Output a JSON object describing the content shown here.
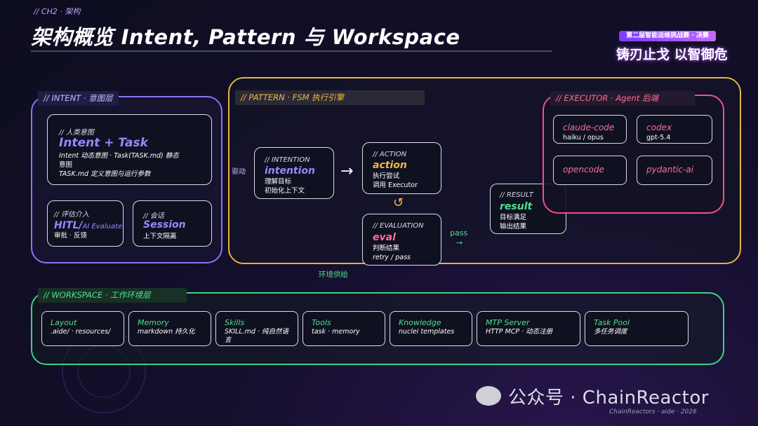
{
  "header": {
    "breadcrumb": "// CH2 · 架构",
    "title": "架构概览 Intent, Pattern 与 Workspace",
    "badge_top": "第二届智能运维挑战赛 · 决赛",
    "badge_main": "铸刃止戈 以智御危"
  },
  "intent": {
    "tag": "// INTENT · 意图层",
    "human": {
      "label": "// 人类意图",
      "title": "Intent + Task",
      "desc1": "Intent 动态意图 · Task(TASK.md) 静态",
      "desc2": "意图",
      "desc3": "TASK.md 定义意图与运行参数"
    },
    "hitl": {
      "label": "// 评估介入",
      "title_a": "HITL/",
      "title_b": "AI Evaluate",
      "desc": "审批 · 反馈"
    },
    "session": {
      "label": "// 会话",
      "title": "Session",
      "desc": "上下文隔离"
    }
  },
  "pattern": {
    "tag": "// PATTERN · FSM 执行引擎",
    "drive": "驱动",
    "intention": {
      "label": "// INTENTION",
      "title": "intention",
      "desc1": "理解目标",
      "desc2": "初始化上下文"
    },
    "arrow": "→",
    "action": {
      "label": "// ACTION",
      "title": "action",
      "desc1": "执行尝试",
      "desc2": "调用 Executor"
    },
    "loop": "↺",
    "evaluation": {
      "label": "// EVALUATION",
      "title": "eval",
      "desc1": "判断结果",
      "desc2": "retry / pass"
    },
    "pass": "pass",
    "pass_arrow": "→",
    "result": {
      "label": "// RESULT",
      "title": "result",
      "desc1": "目标满足",
      "desc2": "输出结果"
    },
    "supply": "环境供给"
  },
  "executor": {
    "tag": "// EXECUTOR · Agent 后端",
    "agents": [
      {
        "name": "claude-code",
        "sub": "haiku / opus"
      },
      {
        "name": "codex",
        "sub": "gpt-5.4"
      },
      {
        "name": "opencode",
        "sub": ""
      },
      {
        "name": "pydantic-ai",
        "sub": ""
      }
    ]
  },
  "workspace": {
    "tag": "// WORKSPACE · 工作环境层",
    "items": [
      {
        "name": "Layout",
        "sub": ".aide/ · resources/"
      },
      {
        "name": "Memory",
        "sub": "markdown 持久化"
      },
      {
        "name": "Skills",
        "sub": "SKILL.md · 纯自然语言"
      },
      {
        "name": "Tools",
        "sub": "task · memory"
      },
      {
        "name": "Knowledge",
        "sub": "nuclei templates"
      },
      {
        "name": "MTP Server",
        "sub": "HTTP MCP · 动态注册"
      },
      {
        "name": "Task Pool",
        "sub": "多任务调度"
      }
    ]
  },
  "footer": {
    "watermark": "公众号 · ChainReactor",
    "credit": "ChainReactors · aide · 2026"
  },
  "colors": {
    "intent": "#8a74f5",
    "pattern": "#e8b23d",
    "executor": "#f0508a",
    "workspace": "#3fcf83"
  }
}
